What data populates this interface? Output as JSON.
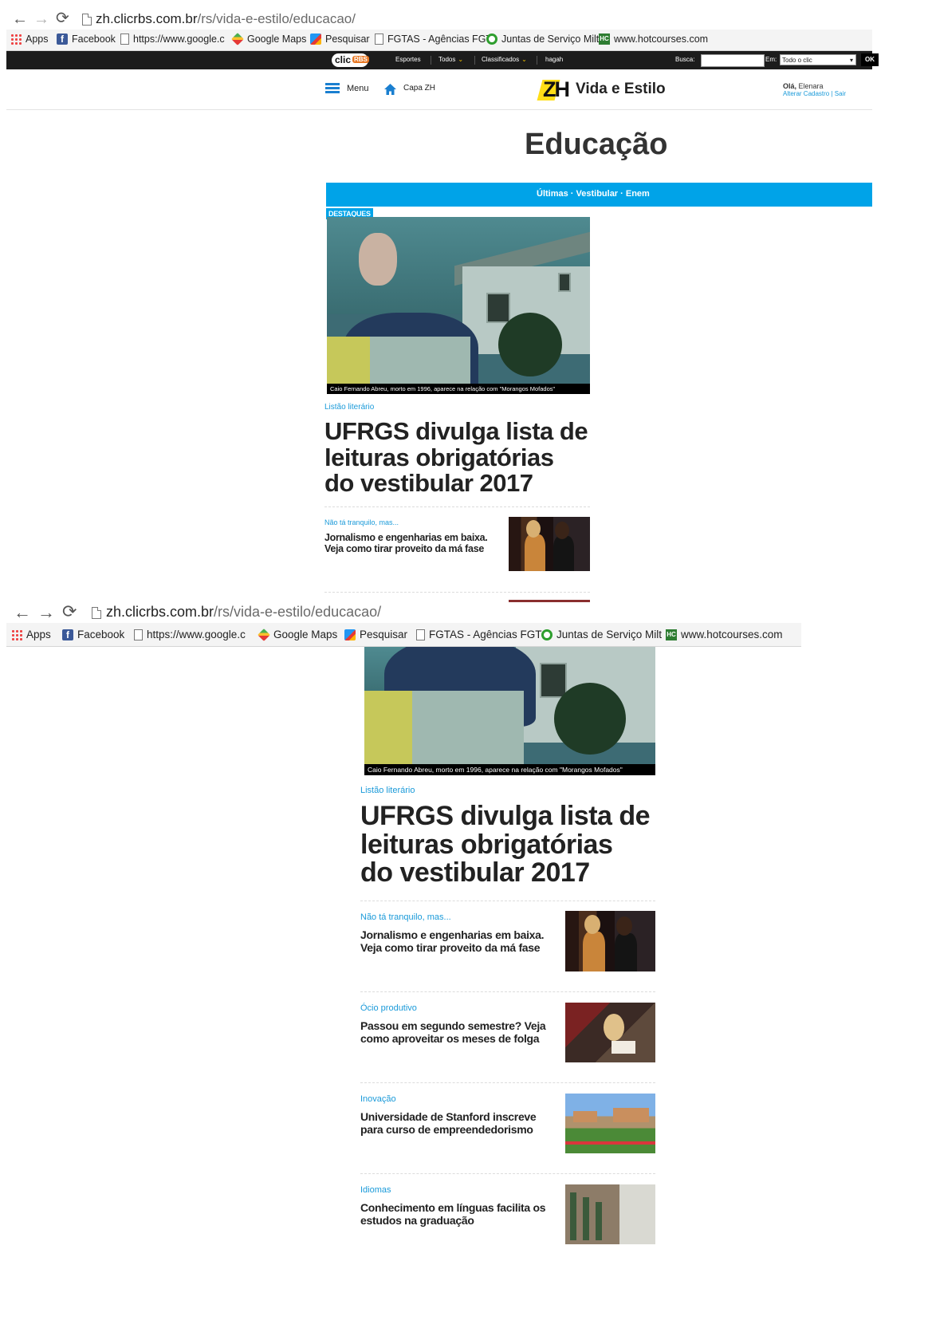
{
  "browser": {
    "url_host": "zh.clicrbs.com.br",
    "url_path": "/rs/vida-e-estilo/educacao/",
    "bookmarks": [
      {
        "label": "Apps",
        "icon": "apps-grid-icon"
      },
      {
        "label": "Facebook",
        "icon": "facebook-icon"
      },
      {
        "label": "https://www.google.c",
        "icon": "page-icon"
      },
      {
        "label": "Google Maps",
        "icon": "maps-icon"
      },
      {
        "label": "Pesquisar",
        "icon": "search-site-icon"
      },
      {
        "label": "FGTAS - Agências FGT",
        "icon": "page-icon"
      },
      {
        "label": "Juntas de Serviço Milt",
        "icon": "juntas-icon"
      },
      {
        "label": "www.hotcourses.com",
        "icon": "hotcourses-icon"
      }
    ]
  },
  "clic_bar": {
    "logo_main": "clic",
    "logo_sub": "RBS",
    "items": [
      "Esportes",
      "Todos",
      "Classificados",
      "hagah"
    ],
    "busca_label": "Busca:",
    "em_label": "Em:",
    "em_value": "Todo o clic",
    "ok_label": "OK"
  },
  "header": {
    "menu_label": "Menu",
    "capa_label": "Capa ZH",
    "logo_text": "ZH",
    "section_name": "Vida e Estilo",
    "greeting": "Olá,",
    "user_name": "Elenara",
    "account_links": "Alterar Cadastro | Sair"
  },
  "page": {
    "title": "Educação",
    "subnav": "Últimas · Vestibular · Enem",
    "destaques_label": "DESTAQUES"
  },
  "featured": {
    "caption": "Caio Fernando Abreu, morto em 1996, aparece na relação com \"Morangos Mofados\"",
    "category": "Listão literário",
    "headline_lines": [
      "UFRGS divulga lista de",
      "leituras obrigatórias",
      "do vestibular 2017"
    ]
  },
  "articles": [
    {
      "category": "Não tá tranquilo, mas...",
      "lines": [
        "Jornalismo e engenharias em baixa.",
        "Veja como tirar proveito da má fase"
      ],
      "thumb": "two-women-photo"
    },
    {
      "category": "Ócio produtivo",
      "lines": [
        "Passou em segundo semestre? Veja",
        "como aproveitar os meses de folga"
      ],
      "thumb": "student-reading-photo"
    },
    {
      "category": "Inovação",
      "lines": [
        "Universidade de Stanford inscreve",
        "para curso de empreendedorismo"
      ],
      "thumb": "stanford-campus-photo"
    },
    {
      "category": "Idiomas",
      "lines": [
        "Conhecimento em línguas facilita os",
        "estudos na graduação"
      ],
      "thumb": "library-students-photo"
    }
  ]
}
